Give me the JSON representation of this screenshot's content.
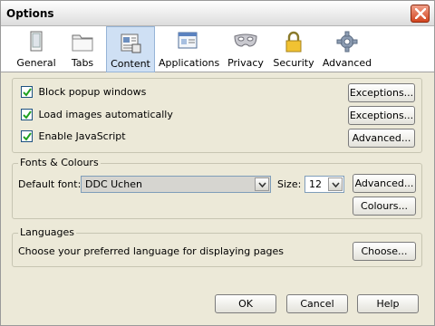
{
  "window": {
    "title": "Options"
  },
  "toolbar": {
    "items": [
      {
        "label": "General",
        "icon": "general-icon"
      },
      {
        "label": "Tabs",
        "icon": "tabs-icon"
      },
      {
        "label": "Content",
        "icon": "content-icon",
        "selected": true
      },
      {
        "label": "Applications",
        "icon": "applications-icon"
      },
      {
        "label": "Privacy",
        "icon": "privacy-mask-icon"
      },
      {
        "label": "Security",
        "icon": "padlock-icon"
      },
      {
        "label": "Advanced",
        "icon": "gear-icon"
      }
    ]
  },
  "content": {
    "block_popups": {
      "label": "Block popup windows",
      "checked": true
    },
    "load_images": {
      "label": "Load images automatically",
      "checked": true
    },
    "enable_js": {
      "label": "Enable JavaScript",
      "checked": true
    },
    "exceptions_popup_label": "Exceptions...",
    "exceptions_images_label": "Exceptions...",
    "advanced_js_label": "Advanced..."
  },
  "fonts": {
    "group_title": "Fonts & Colours",
    "default_font_label": "Default font:",
    "default_font_value": "DDC Uchen",
    "size_label": "Size:",
    "size_value": "12",
    "advanced_label": "Advanced...",
    "colours_label": "Colours..."
  },
  "languages": {
    "group_title": "Languages",
    "description": "Choose your preferred language for displaying pages",
    "choose_label": "Choose..."
  },
  "footer": {
    "ok_label": "OK",
    "cancel_label": "Cancel",
    "help_label": "Help"
  },
  "colors": {
    "dialog_bg": "#ece9d8",
    "selected_tab": "#cfe0f4",
    "close_button": "#d2451f"
  }
}
